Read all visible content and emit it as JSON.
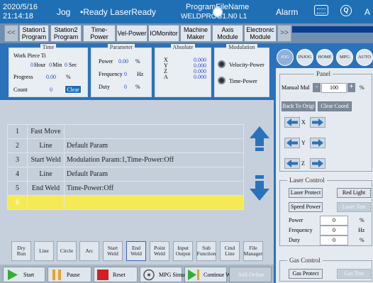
{
  "header": {
    "date": "2020/5/16",
    "time": "21:14:18",
    "mode": "Jog",
    "status": "•Ready LaserReady",
    "program_label": "ProgramFileName",
    "program_file": "WELDPROG1.N0 L1",
    "alarm": "Alarm",
    "extra": "A",
    "colors": {
      "bar": "#1f6fb5",
      "selected_row": "#f5ea56"
    }
  },
  "tabs": [
    {
      "label": "Station1 Program"
    },
    {
      "label": "Station2 Program"
    },
    {
      "label": "Time-Power"
    },
    {
      "label": "Vel-Power"
    },
    {
      "label": "IOMonitor"
    },
    {
      "label": "Machine Maker"
    },
    {
      "label": "Axis Module"
    },
    {
      "label": "Electronic Module"
    }
  ],
  "time_group": {
    "title": "Time",
    "work_piece": "Work Piece Ti",
    "hour_val": "0",
    "hour_unit": "Hour",
    "min_val": "0",
    "min_unit": "Min",
    "sec_val": "0",
    "sec_unit": "Sec",
    "progress_label": "Progress",
    "progress_val": "0.00",
    "progress_unit": "%",
    "count_label": "Count",
    "count_val": "0",
    "clear_label": "Clear"
  },
  "parameter_group": {
    "title": "Parameter",
    "power_label": "Power",
    "power_val": "0.00",
    "power_unit": "%",
    "freq_label": "Frequency",
    "freq_val": "0",
    "freq_unit": "Hz",
    "duty_label": "Duty",
    "duty_val": "0",
    "duty_unit": "%"
  },
  "absolute_group": {
    "title": "Absolute",
    "axes": [
      {
        "name": "X",
        "value": "0.000"
      },
      {
        "name": "Y",
        "value": "0.000"
      },
      {
        "name": "Z",
        "value": "0.000"
      },
      {
        "name": "A",
        "value": "0.000"
      }
    ]
  },
  "modulation_group": {
    "title": "Modulation",
    "option1": "Velocity-Power",
    "option2": "Time-Power"
  },
  "program_rows": [
    {
      "no": "1",
      "cmd": "Fast Move",
      "param": ""
    },
    {
      "no": "2",
      "cmd": "Line",
      "param": "Default Param"
    },
    {
      "no": "3",
      "cmd": "Start Weld",
      "param": "Modulation Param:1,Time-Power:Off"
    },
    {
      "no": "4",
      "cmd": "Line",
      "param": "Default Param"
    },
    {
      "no": "5",
      "cmd": "End Weld",
      "param": "Time-Power:Off"
    },
    {
      "no": "6",
      "cmd": "",
      "param": ""
    }
  ],
  "func_keys": [
    {
      "label": "Dry Run"
    },
    {
      "label": "Line"
    },
    {
      "label": "Circle"
    },
    {
      "label": "Arc"
    },
    {
      "label": "Start Weld"
    },
    {
      "label": "End Weld"
    },
    {
      "label": "Point Weld"
    },
    {
      "label": "Input Output"
    },
    {
      "label": "Sub Function"
    },
    {
      "label": "Cmd Line"
    },
    {
      "label": "File Manager"
    }
  ],
  "actions": {
    "start": "Start",
    "pause": "Pause",
    "reset": "Reset",
    "mpg": "MPG Simu",
    "continue": "Continue Weld",
    "self_define": "Self Define"
  },
  "modes": [
    "JOG",
    "INJOG",
    "HOME",
    "MPG",
    "AUTO"
  ],
  "panel": {
    "title": "Panel",
    "manual_label": "Manual Mul",
    "manual_value": "100",
    "manual_unit": "%",
    "back_origin": "Back To Origin",
    "clear_coord": "Clear Coord",
    "axis_x": "X",
    "axis_y": "Y",
    "axis_z": "Z"
  },
  "laser_control": {
    "title": "Laser Control",
    "laser_protect": "Laser Protect",
    "red_light": "Red Light",
    "speed_power": "Speed Power",
    "laser_test": "Laser Test",
    "power_label": "Power",
    "power_val": "0",
    "power_unit": "%",
    "freq_label": "Frequency",
    "freq_val": "0",
    "freq_unit": "Hz",
    "duty_label": "Duty",
    "duty_val": "0",
    "duty_unit": "%"
  },
  "gas_control": {
    "title": "Gas Control",
    "gas_protect": "Gas Protect",
    "gas_test": "Gas Test"
  }
}
